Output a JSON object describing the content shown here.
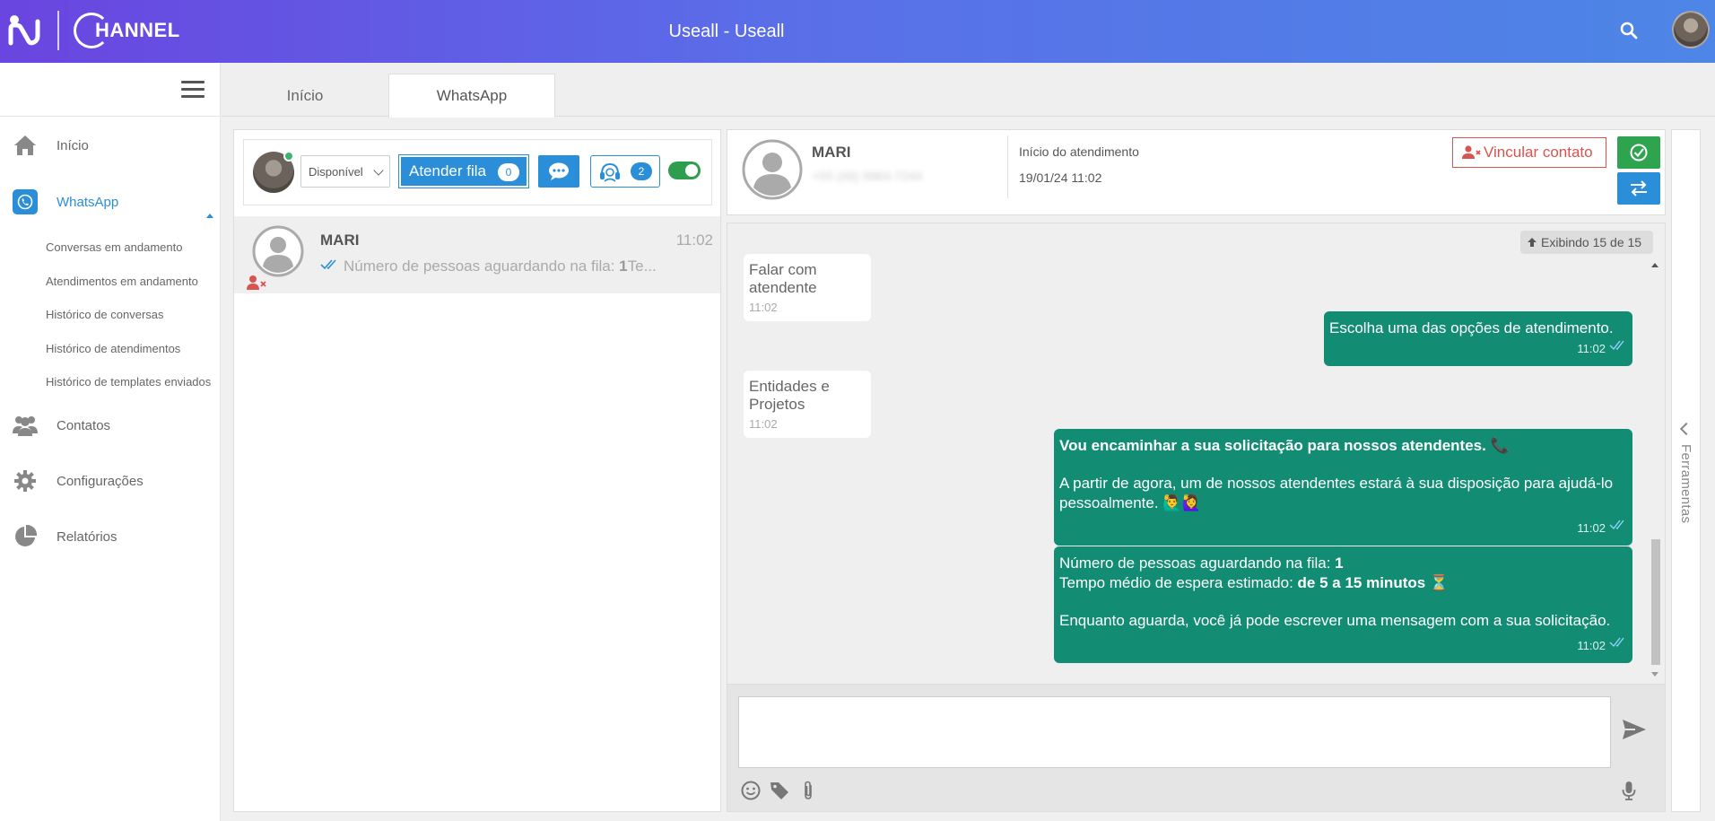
{
  "header": {
    "brand": "HANNEL",
    "title": "Useall - Useall"
  },
  "sidebar": {
    "items": [
      {
        "label": "Início",
        "icon": "home-icon"
      },
      {
        "label": "WhatsApp",
        "icon": "whatsapp-icon"
      },
      {
        "label": "Contatos",
        "icon": "contacts-icon"
      },
      {
        "label": "Configurações",
        "icon": "gear-icon"
      },
      {
        "label": "Relatórios",
        "icon": "pie-chart-icon"
      }
    ],
    "sub_items": [
      "Conversas em andamento",
      "Atendimentos em andamento",
      "Histórico de conversas",
      "Histórico de atendimentos",
      "Histórico de templates enviados"
    ]
  },
  "tabs": [
    {
      "label": "Início"
    },
    {
      "label": "WhatsApp"
    }
  ],
  "toolbar": {
    "status": "Disponível",
    "queue_button": "Atender fila",
    "queue_count": "0",
    "agents_count": "2"
  },
  "conversations": [
    {
      "name": "MARI",
      "time": "11:02",
      "preview_prefix": "Número de pessoas aguardando na fila: ",
      "preview_bold": "1",
      "preview_suffix": "Te..."
    }
  ],
  "chat_header": {
    "contact_name": "MARI",
    "contact_phone": "+55 (48) 9964-7244",
    "start_label": "Início do atendimento",
    "start_date": "19/01/24 11:02",
    "link_contact_button": "Vincular contato"
  },
  "chat": {
    "showing": "Exibindo 15 de 15",
    "messages": [
      {
        "dir": "in",
        "text": "Falar com atendente",
        "time": "11:02"
      },
      {
        "dir": "out",
        "text": "Escolha uma das opções de atendimento.",
        "time": "11:02"
      },
      {
        "dir": "in",
        "text": "Entidades e Projetos",
        "time": "11:02"
      },
      {
        "dir": "out",
        "bold": "Vou encaminhar a sua solicitação para nossos atendentes. 📞",
        "text": "A partir de agora, um de nossos atendentes estará à sua disposição para ajudá-lo pessoalmente. 🙋‍♂️🙋‍♀️",
        "time": "11:02"
      },
      {
        "dir": "out",
        "line1": "Número de pessoas aguardando na fila: ",
        "line1_bold": "1",
        "line2": "Tempo médio de espera estimado: ",
        "line2_bold": "de 5 a 15 minutos ⏳",
        "text": "Enquanto aguarda, você já pode escrever uma mensagem com a sua solicitação.",
        "time": "11:02"
      }
    ]
  },
  "tools_rail": {
    "label": "Ferramentas"
  },
  "colors": {
    "accent": "#2a8fd8",
    "outgoing_bubble": "#128c73",
    "danger": "#d9534f",
    "success": "#2ea44f"
  }
}
